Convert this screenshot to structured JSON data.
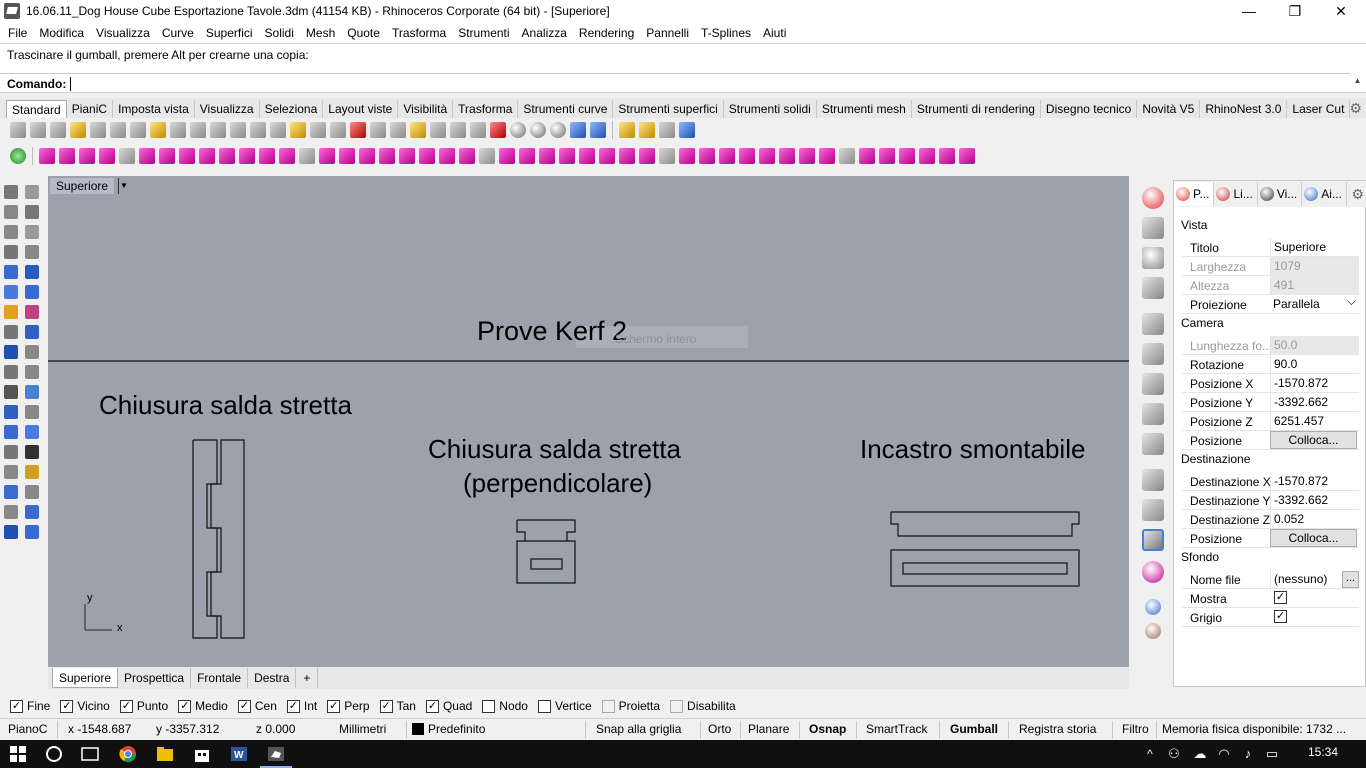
{
  "window": {
    "title": "16.06.11_Dog House Cube Esportazione Tavole.3dm (41154 KB) - Rhinoceros Corporate (64 bit) - [Superiore]",
    "minimize": "—",
    "restore": "❐",
    "close": "✕"
  },
  "menu": [
    "File",
    "Modifica",
    "Visualizza",
    "Curve",
    "Superfici",
    "Solidi",
    "Mesh",
    "Quote",
    "Trasforma",
    "Strumenti",
    "Analizza",
    "Rendering",
    "Pannelli",
    "T-Splines",
    "Aiuti"
  ],
  "command": {
    "history": "Trascinare il gumball, premere Alt per crearne una copia:",
    "prompt": "Comando:",
    "value": ""
  },
  "toolbar_tabs": [
    "Standard",
    "PianiC",
    "Imposta vista",
    "Visualizza",
    "Seleziona",
    "Layout viste",
    "Visibilità",
    "Trasforma",
    "Strumenti curve",
    "Strumenti superfici",
    "Strumenti solidi",
    "Strumenti mesh",
    "Strumenti di rendering",
    "Disegno tecnico",
    "Novità V5",
    "RhinoNest 3.0",
    "Laser Cut"
  ],
  "viewport": {
    "title": "Superiore",
    "texts": {
      "heading": "Prove Kerf 2",
      "ghost": "Schermo intero",
      "label1": "Chiusura salda stretta",
      "label2a": "Chiusura salda stretta",
      "label2b": "(perpendicolare)",
      "label3": "Incastro smontabile",
      "axis_y": "y",
      "axis_x": "x"
    }
  },
  "viewport_tabs": [
    "Superiore",
    "Prospettica",
    "Frontale",
    "Destra",
    "+"
  ],
  "panel": {
    "tabs": [
      {
        "label": "P...",
        "icon": "properties-icon",
        "color": "#e0442c"
      },
      {
        "label": "Li...",
        "icon": "layers-icon",
        "color": "#cc3333"
      },
      {
        "label": "Vi...",
        "icon": "display-icon",
        "color": "#333333"
      },
      {
        "label": "Ai...",
        "icon": "help-icon",
        "color": "#2a6cc8"
      }
    ],
    "sections": {
      "vista": "Vista",
      "camera": "Camera",
      "destinazione": "Destinazione",
      "sfondo": "Sfondo"
    },
    "vista": [
      {
        "key": "Titolo",
        "value": "Superiore",
        "disabled": false
      },
      {
        "key": "Larghezza",
        "value": "1079",
        "disabled": true
      },
      {
        "key": "Altezza",
        "value": "491",
        "disabled": true
      },
      {
        "key": "Proiezione",
        "value": "Parallela",
        "disabled": false
      }
    ],
    "camera": [
      {
        "key": "Lunghezza fo...",
        "value": "50.0",
        "disabled": true
      },
      {
        "key": "Rotazione",
        "value": "90.0",
        "disabled": false
      },
      {
        "key": "Posizione X",
        "value": "-1570.872",
        "disabled": false
      },
      {
        "key": "Posizione Y",
        "value": "-3392.662",
        "disabled": false
      },
      {
        "key": "Posizione Z",
        "value": "6251.457",
        "disabled": false
      },
      {
        "key": "Posizione",
        "value": "Colloca...",
        "disabled": false
      }
    ],
    "destinazione": [
      {
        "key": "Destinazione X",
        "value": "-1570.872",
        "disabled": false
      },
      {
        "key": "Destinazione Y",
        "value": "-3392.662",
        "disabled": false
      },
      {
        "key": "Destinazione Z",
        "value": "0.052",
        "disabled": false
      },
      {
        "key": "Posizione",
        "value": "Colloca...",
        "disabled": false
      }
    ],
    "sfondo": [
      {
        "key": "Nome file",
        "value": "(nessuno)",
        "disabled": false
      },
      {
        "key": "Mostra",
        "value": "✓",
        "disabled": false
      },
      {
        "key": "Grigio",
        "value": "✓",
        "disabled": false
      }
    ],
    "ellipsis": "..."
  },
  "osnaps": [
    {
      "label": "Fine",
      "checked": true
    },
    {
      "label": "Vicino",
      "checked": true
    },
    {
      "label": "Punto",
      "checked": true
    },
    {
      "label": "Medio",
      "checked": true
    },
    {
      "label": "Cen",
      "checked": true
    },
    {
      "label": "Int",
      "checked": true
    },
    {
      "label": "Perp",
      "checked": true
    },
    {
      "label": "Tan",
      "checked": true
    },
    {
      "label": "Quad",
      "checked": true
    },
    {
      "label": "Nodo",
      "checked": false
    },
    {
      "label": "Vertice",
      "checked": false
    },
    {
      "label": "Proietta",
      "checked": false,
      "disabled": true
    },
    {
      "label": "Disabilita",
      "checked": false,
      "disabled": true
    }
  ],
  "check_glyph": "✓",
  "statusbar": {
    "cplane": "PianoC",
    "x": "x -1548.687",
    "y": "y -3357.312",
    "z": "z 0.000",
    "units": "Millimetri",
    "layer": "Predefinito",
    "snap": "Snap alla griglia",
    "orto": "Orto",
    "planare": "Planare",
    "osnap": "Osnap",
    "smarttrack": "SmartTrack",
    "gumball": "Gumball",
    "history": "Registra storia",
    "filter": "Filtro",
    "memory": "Memoria fisica disponibile: 1732 ..."
  },
  "taskbar": {
    "time": "15:34"
  },
  "colors": {
    "viewport_bg": "#9ca2ab",
    "accent_magenta": "#c0008f"
  }
}
